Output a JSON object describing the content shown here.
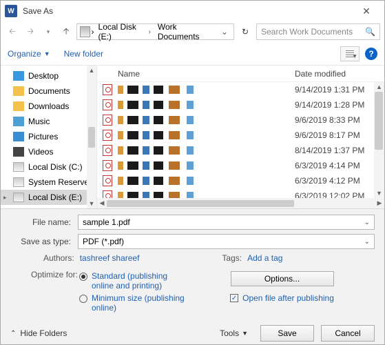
{
  "title": "Save As",
  "path": {
    "root_icon": "drive",
    "seg1": "Local Disk (E:)",
    "seg2": "Work Documents"
  },
  "search": {
    "placeholder": "Search Work Documents"
  },
  "toolbar": {
    "organize": "Organize",
    "new_folder": "New folder"
  },
  "columns": {
    "name": "Name",
    "date": "Date modified"
  },
  "tree": [
    {
      "icon": "desktop",
      "label": "Desktop"
    },
    {
      "icon": "folder",
      "label": "Documents"
    },
    {
      "icon": "folder",
      "label": "Downloads"
    },
    {
      "icon": "music",
      "label": "Music"
    },
    {
      "icon": "pic",
      "label": "Pictures"
    },
    {
      "icon": "video",
      "label": "Videos"
    },
    {
      "icon": "drive",
      "label": "Local Disk (C:)"
    },
    {
      "icon": "drive",
      "label": "System Reserved"
    },
    {
      "icon": "drive",
      "label": "Local Disk (E:)",
      "selected": true,
      "expandable": true
    }
  ],
  "files": [
    {
      "date": "9/14/2019 1:31 PM"
    },
    {
      "date": "9/14/2019 1:28 PM"
    },
    {
      "date": "9/6/2019 8:33 PM"
    },
    {
      "date": "9/6/2019 8:17 PM"
    },
    {
      "date": "8/14/2019 1:37 PM"
    },
    {
      "date": "6/3/2019 4:14 PM"
    },
    {
      "date": "6/3/2019 4:12 PM"
    },
    {
      "date": "6/3/2019 12:02 PM"
    }
  ],
  "form": {
    "file_name_lbl": "File name:",
    "file_name_val": "sample 1.pdf",
    "save_type_lbl": "Save as type:",
    "save_type_val": "PDF (*.pdf)",
    "authors_lbl": "Authors:",
    "authors_val": "tashreef shareef",
    "tags_lbl": "Tags:",
    "tags_val": "Add a tag",
    "optimize_lbl": "Optimize for:",
    "opt1": "Standard (publishing online and printing)",
    "opt2": "Minimum size (publishing online)",
    "options_btn": "Options...",
    "open_after": "Open file after publishing"
  },
  "footer": {
    "hide": "Hide Folders",
    "tools": "Tools",
    "save": "Save",
    "cancel": "Cancel"
  }
}
